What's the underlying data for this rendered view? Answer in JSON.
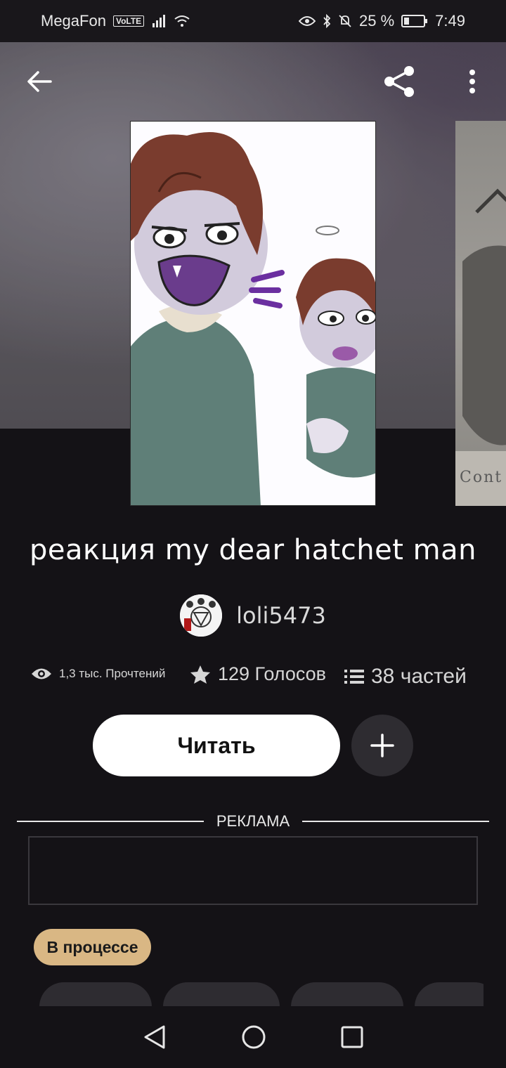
{
  "status_bar": {
    "carrier": "MegaFon",
    "volte": "VoLTE",
    "battery": "25 %",
    "time": "7:49"
  },
  "icons": {
    "back": "arrow-left-icon",
    "share": "share-icon",
    "more": "more-vertical-icon",
    "reads": "eye-icon",
    "votes": "star-icon",
    "parts": "list-icon",
    "add": "plus-icon"
  },
  "story": {
    "title": "реакция my dear hatchet man",
    "author": "loli5473",
    "reads": "1,3 тыс. Прочтений",
    "votes": "129 Голосов",
    "parts": "38 частей",
    "status": "В процессе"
  },
  "next_cover": {
    "text": "Cont"
  },
  "actions": {
    "read_label": "Читать"
  },
  "ad": {
    "label": "РЕКЛАМА"
  },
  "colors": {
    "background": "#141216",
    "status_tag": "#d9b784",
    "read_button": "#ffffff"
  }
}
